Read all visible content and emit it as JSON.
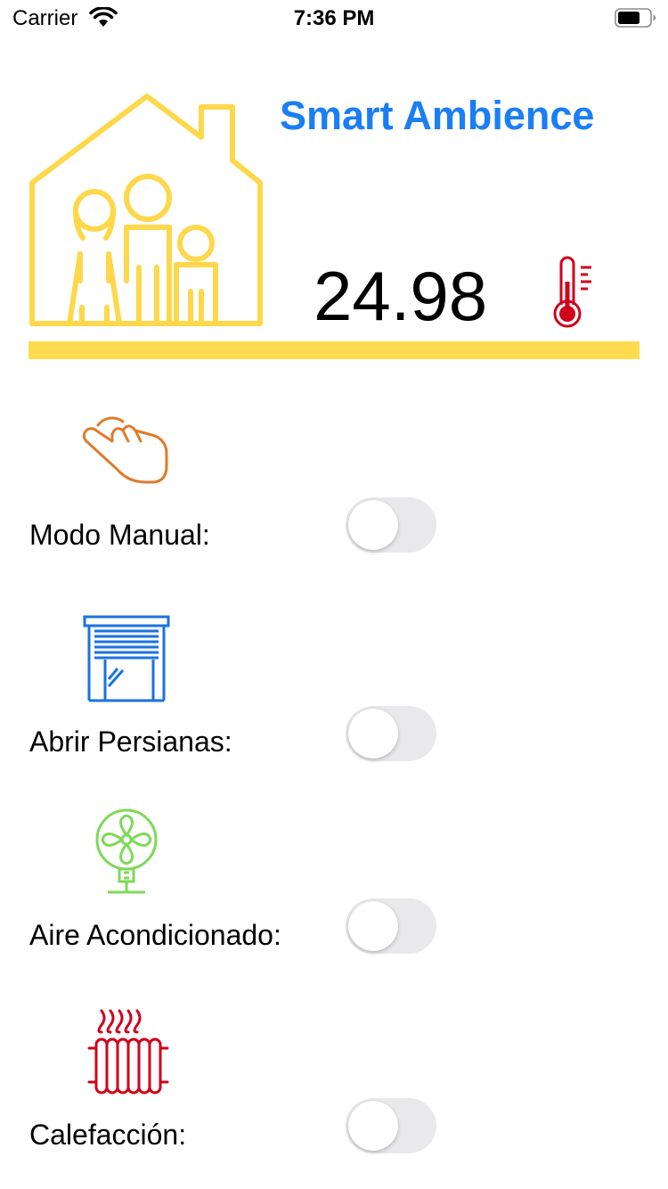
{
  "status_bar": {
    "carrier": "Carrier",
    "time": "7:36 PM"
  },
  "header": {
    "title": "Smart Ambience",
    "temperature": "24.98"
  },
  "controls": [
    {
      "label": "Modo Manual:",
      "icon": "hand-pointer-icon",
      "on": false
    },
    {
      "label": "Abrir Persianas:",
      "icon": "window-blinds-icon",
      "on": false
    },
    {
      "label": "Aire Acondicionado:",
      "icon": "fan-icon",
      "on": false
    },
    {
      "label": "Calefacción:",
      "icon": "radiator-icon",
      "on": false
    }
  ],
  "colors": {
    "title": "#1a7ef5",
    "house": "#fed84a",
    "thermometer": "#d0021b",
    "hand": "#e07b2a",
    "blinds": "#1a72e0",
    "fan": "#7ed957",
    "radiator": "#d0021b",
    "toggle_off": "#e9e9eb"
  }
}
